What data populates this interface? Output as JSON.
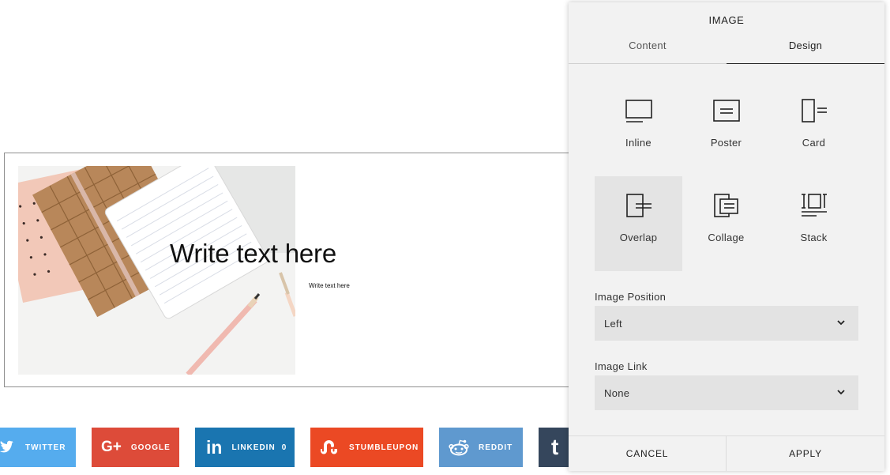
{
  "canvas": {
    "heading": "Write text here",
    "body": "Write text here"
  },
  "share_buttons": [
    {
      "label": "TWITTER",
      "icon": "twitter-bird-icon",
      "color": "#55acee"
    },
    {
      "label": "GOOGLE",
      "icon": "google-plus-icon",
      "color": "#dd4b39"
    },
    {
      "label": "LINKEDIN",
      "count": "0",
      "icon": "linkedin-in-icon",
      "color": "#1a75b0"
    },
    {
      "label": "STUMBLEUPON",
      "icon": "stumbleupon-icon",
      "color": "#eb4924"
    },
    {
      "label": "REDDIT",
      "icon": "reddit-alien-icon",
      "color": "#5f99cf"
    },
    {
      "label": "",
      "icon": "tumblr-t-icon",
      "color": "#35465c"
    }
  ],
  "panel": {
    "title": "IMAGE",
    "tabs": [
      {
        "label": "Content",
        "active": false
      },
      {
        "label": "Design",
        "active": true
      }
    ],
    "layouts": [
      {
        "label": "Inline",
        "icon": "inline-layout-icon",
        "selected": false
      },
      {
        "label": "Poster",
        "icon": "poster-layout-icon",
        "selected": false
      },
      {
        "label": "Card",
        "icon": "card-layout-icon",
        "selected": false
      },
      {
        "label": "Overlap",
        "icon": "overlap-layout-icon",
        "selected": true
      },
      {
        "label": "Collage",
        "icon": "collage-layout-icon",
        "selected": false
      },
      {
        "label": "Stack",
        "icon": "stack-layout-icon",
        "selected": false
      }
    ],
    "image_position": {
      "label": "Image Position",
      "value": "Left"
    },
    "image_link": {
      "label": "Image Link",
      "value": "None"
    },
    "cancel_label": "CANCEL",
    "apply_label": "APPLY"
  }
}
